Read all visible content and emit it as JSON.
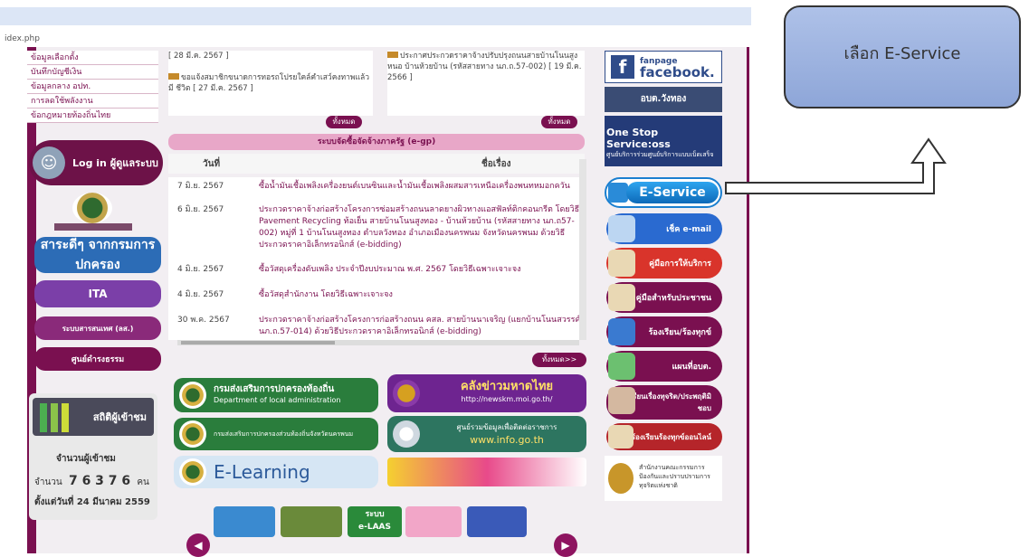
{
  "browser": {
    "url": "idex.php"
  },
  "left_menu": {
    "items": [
      {
        "label": "ข้อมูลเลือกตั้ง"
      },
      {
        "label": "บันทึกบัญชีเงิน"
      },
      {
        "label": "ข้อมูลกลาง อปท."
      },
      {
        "label": "การลดใช้พลังงาน"
      },
      {
        "label": "ข้อกฎหมายท้องถิ่นไทย"
      }
    ],
    "login_label": "Log in ผู้ดูแลระบบ",
    "banners": [
      {
        "label": "สาระดีๆ จากกรมการปกครอง"
      },
      {
        "label": "ITA"
      },
      {
        "label": "ระบบสารสนเทศ (ลส.)"
      },
      {
        "label": "ศูนย์ดำรงธรรม"
      }
    ]
  },
  "stats": {
    "title": "สถิติผู้เข้าชม",
    "visitors_label": "จำนวนผู้เข้าชม",
    "count_prefix": "จำนวน",
    "count": "7 6 3 7 6",
    "count_unit": "คน",
    "since": "ตั้งแต่วันที่ 24 มีนาคม 2559"
  },
  "news": {
    "left": {
      "date_top": "[ 28 มี.ค. 2567 ]",
      "item": "ขอแจ้งสมาชิกขนาดการทอรถโปรยใคล์คำเสว์คงทาพแล้วมี ชีวิต [ 27 มี.ค. 2567 ]",
      "more": "ทั้งหมด"
    },
    "right": {
      "item": "ประกาศประกวดราคาจ้างปรับปรุงถนนสายบ้านโนนสูง หนอ บ้านห้วยบ้าน (รหัสสายทาง นภ.ถ.57-002) [ 19 มี.ค. 2566 ]",
      "more": "ทั้งหมด"
    }
  },
  "procurement": {
    "title": "ระบบจัดซื้อจัดจ้างภาครัฐ (e-gp)",
    "col_date": "วันที่",
    "col_subject": "ชื่อเรื่อง",
    "rows": [
      {
        "date": "7 มิ.ย. 2567",
        "subject": "ซื้อน้ำมันเชื้อเพลิงเครื่องยนต์เบนซินและน้ำมันเชื้อเพลิงผสมสารเหนือเครื่องพนทหมอกควัน"
      },
      {
        "date": "6 มิ.ย. 2567",
        "subject": "ประกวดราคาจ้างก่อสร้างโครงการซ่อมสร้างถนนลาดยางผิวทางแอสฟัลท์ติกคอนกรีต โดยวิธี Pavement Recycling ท้อเย็น สายบ้านโนนสูงทอง - บ้านห้วยบ้าน (รหัสสายทาง นภ.ถ57-002) หมู่ที่ 1 บ้านโนนสูงทอง ตำบลวังทอง อำเภอเมืองนครพนม จังหวัดนครพนม ด้วยวิธีประกวดราคาอิเล็กทรอนิกส์ (e-bidding)"
      },
      {
        "date": "4 มิ.ย. 2567",
        "subject": "ซื้อวัสดุเครื่องดับเพลิง ประจำปีงบประมาณ พ.ศ. 2567 โดยวิธีเฉพาะเจาะจง"
      },
      {
        "date": "4 มิ.ย. 2567",
        "subject": "ซื้อวัสดุสำนักงาน โดยวิธีเฉพาะเจาะจง"
      },
      {
        "date": "30 พ.ค. 2567",
        "subject": "ประกวดราคาจ้างก่อสร้างโครงการก่อสร้างถนน คสล. สายบ้านนาเจริญ (แยกบ้านโนนสวรรค์) นภ.ถ.57-014) ด้วยวิธีประกวดราคาอิเล็กทรอนิกส์ (e-bidding)"
      }
    ],
    "more": "ทั้งหมด>>"
  },
  "banners": {
    "dla_th": "กรมส่งเสริมการปกครองท้องถิ่น",
    "dla_en": "Department of local administration",
    "knowledge_title": "คลังข่าวมหาดไทย",
    "knowledge_url": "http://newskm.moi.go.th/",
    "dla_sub": "กรมส่งเสริมการปกครองส่วนท้องถิ่นจังหวัดนครพนม",
    "info_title": "ศูนย์รวมข้อมูลเพื่อติดต่อราชการ",
    "info_url": "www.info.go.th",
    "elearning": "E-Learning",
    "laas_top": "ระบบ",
    "laas": "e-LAAS"
  },
  "right_col": {
    "fanpage": "fanpage",
    "facebook": "facebook.",
    "org_name": "อบต.วังทอง",
    "oss_title": "One Stop Service:oss",
    "oss_sub": "ศูนย์บริการร่วมศูนย์บริการแบบเบ็ดเสร็จ",
    "eservice": "E-Service",
    "email": "เช็ค e-mail",
    "buttons": [
      {
        "label": "คู่มือการให้บริการ",
        "color": "#d9342b"
      },
      {
        "label": "คู่มือสำหรับประชาชน",
        "color": "#7a1050"
      },
      {
        "label": "ร้องเรียน/ร้องทุกข์",
        "color": "#7a1050"
      },
      {
        "label": "แผนที่อบต.",
        "color": "#7a1050"
      },
      {
        "label": "ร้องเรียนเรื่องทุจริต/ประพฤติมิชอบ",
        "color": "#7a1050"
      },
      {
        "label": "ร้องเรียนร้องทุกข์ออนไลน์",
        "color": "#b5252a"
      }
    ],
    "etc_notice": "สำนักงานคณะกรรมการป้องกันและปราบปรามการทุจริตแห่งชาติ"
  },
  "callout": {
    "text": "เลือก E-Service"
  },
  "colors": {
    "accent": "#7a1050",
    "eservice": "#1a7fd0",
    "callout": "#9fb4e2"
  }
}
